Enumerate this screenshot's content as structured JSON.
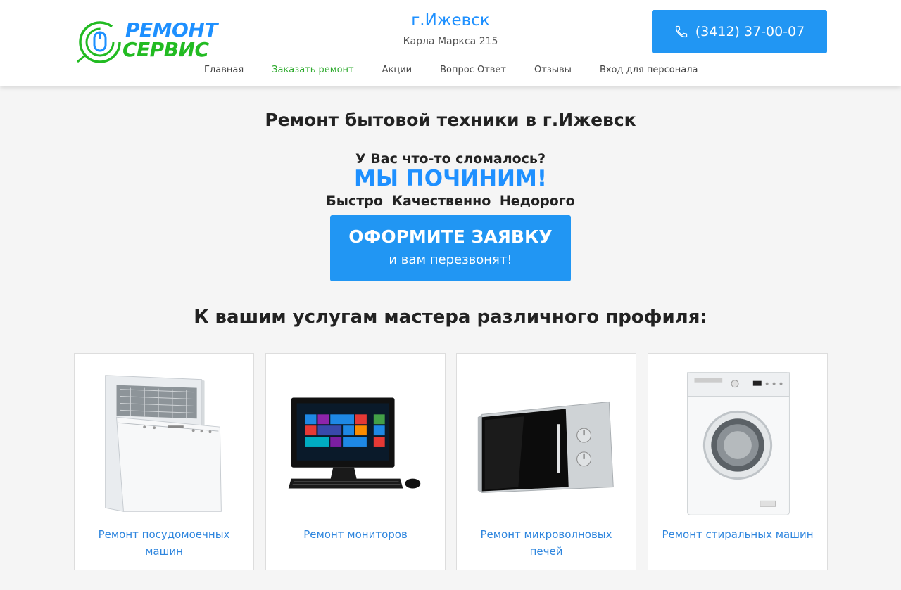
{
  "logo": {
    "line1": "РЕМОНТ",
    "line2": "СЕРВИС",
    "icon": "mouse-logo-icon"
  },
  "header": {
    "city": "г.Ижевск",
    "address": "Карла Маркса 215",
    "phone": "(3412) 37-00-07",
    "phone_icon": "phone-icon"
  },
  "nav": {
    "items": [
      {
        "label": "Главная"
      },
      {
        "label": "Заказать ремонт"
      },
      {
        "label": "Акции"
      },
      {
        "label": "Вопрос Ответ"
      },
      {
        "label": "Отзывы"
      },
      {
        "label": "Вход для персонала"
      }
    ]
  },
  "hero": {
    "title": "Ремонт бытовой техники в г.Ижевск",
    "question": "У Вас что-то сломалось?",
    "slogan": "МЫ ПОЧИНИМ!",
    "advantages": "Быстро  Качественно  Недорого",
    "order_title": "ОФОРМИТЕ ЗАЯВКУ",
    "order_sub": "и вам перезвонят!"
  },
  "services": {
    "title": "К вашим услугам мастера различного профиля:",
    "cards": [
      {
        "label": "Ремонт посудомоечных машин",
        "icon": "dishwasher-image"
      },
      {
        "label": "Ремонт мониторов",
        "icon": "monitor-image"
      },
      {
        "label": "Ремонт микроволновых печей",
        "icon": "microwave-image"
      },
      {
        "label": "Ремонт стиральных машин",
        "icon": "washing-machine-image"
      }
    ]
  },
  "colors": {
    "accent": "#2196f3",
    "green": "#22bb22",
    "link": "#2f86de"
  }
}
